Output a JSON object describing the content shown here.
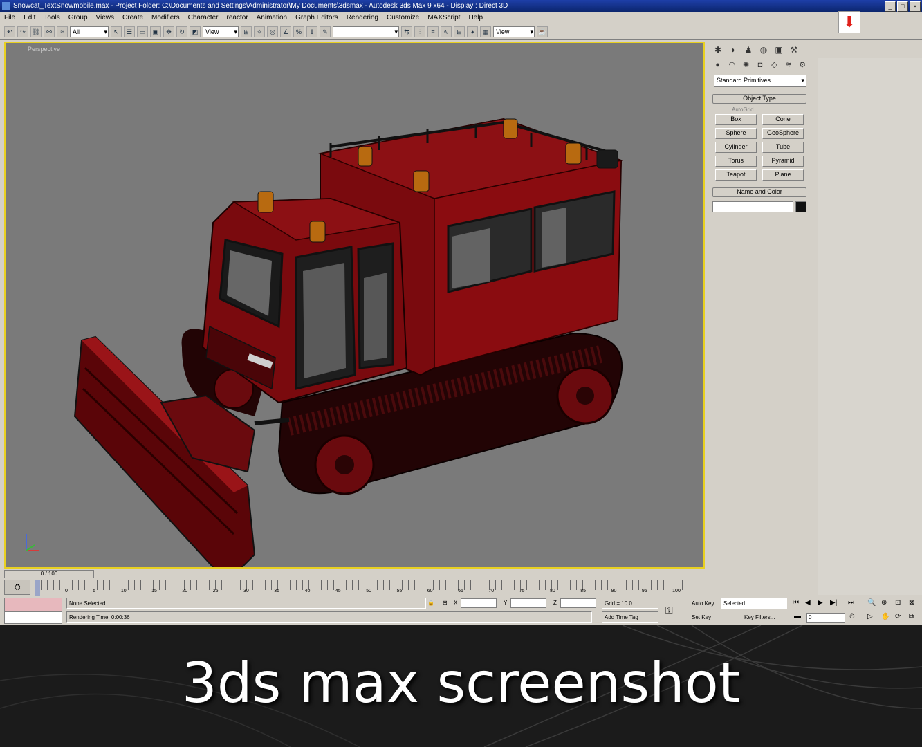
{
  "window": {
    "title": "Snowcat_TextSnowmobile.max - Project Folder: C:\\Documents and Settings\\Administrator\\My Documents\\3dsmax - Autodesk 3ds Max 9 x64 - Display : Direct 3D"
  },
  "menu": {
    "items": [
      "File",
      "Edit",
      "Tools",
      "Group",
      "Views",
      "Create",
      "Modifiers",
      "Character",
      "reactor",
      "Animation",
      "Graph Editors",
      "Rendering",
      "Customize",
      "MAXScript",
      "Help"
    ]
  },
  "toolbar": {
    "selection_filter": "All",
    "ref_coord": "View",
    "named_selection": "",
    "render_view": "View"
  },
  "viewport": {
    "label": "Perspective",
    "background": "#7a7a7a",
    "active_border": "#e8d020",
    "model_color": "#7a0a0e"
  },
  "command_panel": {
    "category": "Standard Primitives",
    "object_type_header": "Object Type",
    "autogrid_label": "AutoGrid",
    "primitives": [
      "Box",
      "Cone",
      "Sphere",
      "GeoSphere",
      "Cylinder",
      "Tube",
      "Torus",
      "Pyramid",
      "Teapot",
      "Plane"
    ],
    "name_color_header": "Name and Color"
  },
  "timeline": {
    "slider_label": "0 / 100",
    "ticks": [
      "0",
      "5",
      "10",
      "15",
      "20",
      "25",
      "30",
      "35",
      "40",
      "45",
      "50",
      "55",
      "60",
      "65",
      "70",
      "75",
      "80",
      "85",
      "90",
      "95",
      "100"
    ]
  },
  "status": {
    "selection": "None Selected",
    "prompt": "Rendering Time: 0:00:36",
    "x_label": "X",
    "y_label": "Y",
    "z_label": "Z",
    "grid": "Grid = 10.0",
    "add_time_tag": "Add Time Tag",
    "auto_key": "Auto Key",
    "set_key": "Set Key",
    "key_mode": "Selected",
    "key_filters": "Key Filters...",
    "frame": "0"
  },
  "banner": {
    "caption": "3ds max screenshot"
  }
}
